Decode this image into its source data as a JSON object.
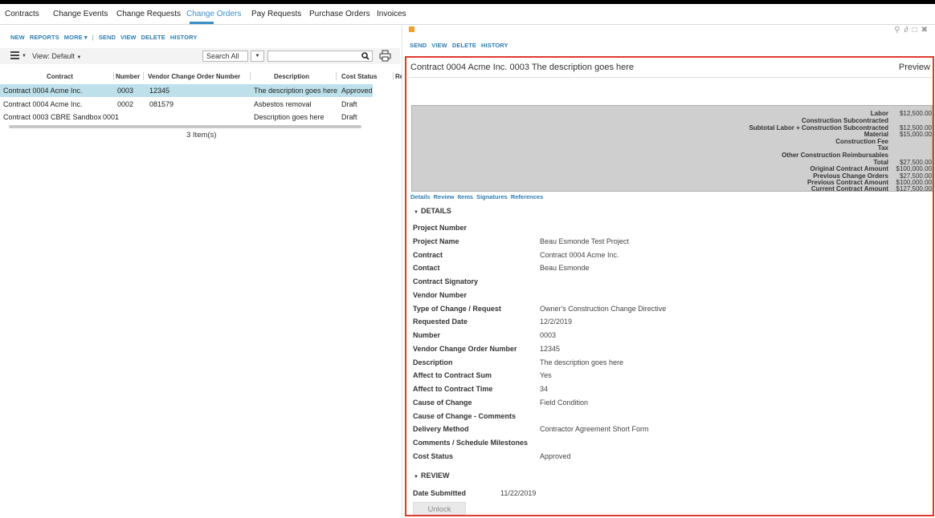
{
  "top_tabs": [
    "Contracts",
    "Change Events",
    "Change Requests",
    "Change Orders",
    "Pay Requests",
    "Purchase Orders",
    "Invoices"
  ],
  "active_tab": "Change Orders",
  "accent_color": "#3b8fc7",
  "left_toolbar": [
    "NEW",
    "REPORTS",
    "MORE ▾",
    "|",
    "SEND",
    "VIEW",
    "DELETE",
    "HISTORY"
  ],
  "view_bar": {
    "view_label": "View: Default",
    "search_scope": "Search All",
    "search_value": ""
  },
  "grid": {
    "columns": [
      "Contract",
      "Number",
      "Vendor Change Order Number",
      "Description",
      "Cost Status",
      "Re"
    ],
    "rows": [
      {
        "contract": "Contract 0004 Acme Inc.",
        "number": "0003",
        "vendor_co": "12345",
        "description": "The description goes here",
        "cost_status": "Approved",
        "selected": true
      },
      {
        "contract": "Contract 0004 Acme Inc.",
        "number": "0002",
        "vendor_co": "081579",
        "description": "Asbestos removal",
        "cost_status": "Draft",
        "selected": false
      },
      {
        "contract": "Contract 0003 CBRE Sandbox",
        "number": "0001",
        "vendor_co": "",
        "description": "Description goes here",
        "cost_status": "Draft",
        "selected": false
      }
    ],
    "item_count": "3 Item(s)"
  },
  "right_toolbar": [
    "SEND",
    "VIEW",
    "DELETE",
    "HISTORY"
  ],
  "window_icons": [
    "pin-icon",
    "link-icon",
    "maximize-icon",
    "close-icon"
  ],
  "preview": {
    "title": "Contract 0004 Acme Inc. 0003 The description goes here",
    "preview_label": "Preview",
    "highlight_color": "#e03a2f",
    "summary": [
      {
        "label": "Labor",
        "value": "$12,500.00"
      },
      {
        "label": "Construction Subcontracted",
        "value": ""
      },
      {
        "label": "Subtotal Labor + Construction Subcontracted",
        "value": "$12,500.00"
      },
      {
        "label": "Material",
        "value": "$15,000.00"
      },
      {
        "label": "Construction Fee",
        "value": ""
      },
      {
        "label": "Tax",
        "value": ""
      },
      {
        "label": "Other Construction Reimbursables",
        "value": ""
      },
      {
        "label": "Total",
        "value": "$27,500.00"
      },
      {
        "label": "Original Contract Amount",
        "value": "$100,000.00"
      },
      {
        "label": "Previous Change Orders",
        "value": "$27,500.00"
      },
      {
        "label": "Previous Contract Amount",
        "value": "$100,000.00"
      },
      {
        "label": "Current Contract Amount",
        "value": "$127,500.00"
      }
    ],
    "sub_tabs": [
      "Details",
      "Review",
      "Items",
      "Signatures",
      "References"
    ],
    "details_heading": "DETAILS",
    "details": [
      {
        "label": "Project Number",
        "value": ""
      },
      {
        "label": "Project Name",
        "value": "Beau Esmonde Test Project"
      },
      {
        "label": "Contract",
        "value": "Contract 0004 Acme Inc."
      },
      {
        "label": "Contact",
        "value": "Beau Esmonde"
      },
      {
        "label": "Contract Signatory",
        "value": ""
      },
      {
        "label": "Vendor Number",
        "value": ""
      },
      {
        "label": "Type of Change / Request",
        "value": "Owner's Construction Change Directive"
      },
      {
        "label": "Requested Date",
        "value": "12/2/2019"
      },
      {
        "label": "Number",
        "value": "0003"
      },
      {
        "label": "Vendor Change Order Number",
        "value": "12345"
      },
      {
        "label": "Description",
        "value": "The description goes here"
      },
      {
        "label": "Affect to Contract Sum",
        "value": "Yes"
      },
      {
        "label": "Affect to Contract Time",
        "value": "34"
      },
      {
        "label": "Cause of Change",
        "value": "Field Condition"
      },
      {
        "label": "Cause of Change - Comments",
        "value": ""
      },
      {
        "label": "Delivery Method",
        "value": "Contractor Agreement Short Form"
      },
      {
        "label": "Comments / Schedule Milestones",
        "value": ""
      },
      {
        "label": "Cost Status",
        "value": "Approved"
      }
    ],
    "review_heading": "REVIEW",
    "review": {
      "label": "Date Submitted",
      "value": "11/22/2019"
    },
    "unlock_label": "Unlock"
  }
}
